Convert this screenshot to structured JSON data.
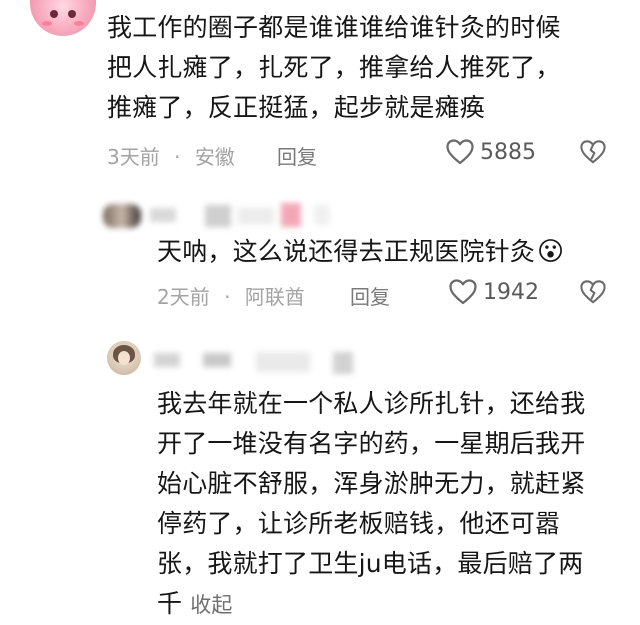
{
  "comments": [
    {
      "lines": [
        "我工作的圈子都是谁谁谁给谁针灸的时候",
        "把人扎瘫了，扎死了，推拿给人推死了，",
        "推瘫了，反正挺猛，起步就是瘫痪"
      ],
      "time": "3天前",
      "dot": "·",
      "location": "安徽",
      "reply_label": "回复",
      "likes": "5885"
    },
    {
      "text": "天呐，这么说还得去正规医院针灸",
      "emoji": "😮",
      "time": "2天前",
      "dot": "·",
      "location": "阿联酋",
      "reply_label": "回复",
      "likes": "1942"
    },
    {
      "lines": [
        "我去年就在一个私人诊所扎针，还给我",
        "开了一堆没有名字的药，一星期后我开",
        "始心脏不舒服，浑身淤肿无力，就赶紧",
        "停药了，让诊所老板赔钱，他还可嚣",
        "张，我就打了卫生ju电话，最后赔了两",
        "千"
      ],
      "collapse_label": "收起"
    }
  ],
  "icons": {
    "like": "heart-outline-icon",
    "dislike": "broken-heart-icon"
  },
  "colors": {
    "text": "#161616",
    "meta": "#a3a3a3",
    "icon": "#6a6a6a"
  }
}
